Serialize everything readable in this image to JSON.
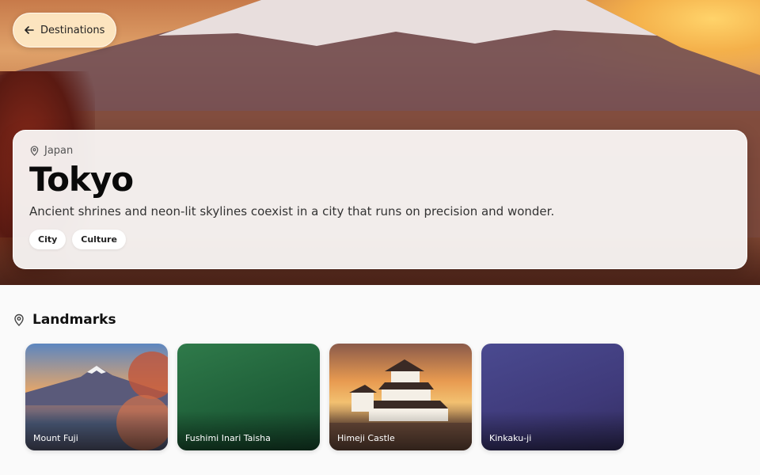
{
  "nav": {
    "back_label": "Destinations"
  },
  "hero": {
    "country": "Japan",
    "city": "Tokyo",
    "description": "Ancient shrines and neon-lit skylines coexist in a city that runs on precision and wonder.",
    "tags": [
      "City",
      "Culture"
    ]
  },
  "landmarks": {
    "title": "Landmarks",
    "items": [
      {
        "name": "Mount Fuji"
      },
      {
        "name": "Fushimi Inari Taisha"
      },
      {
        "name": "Himeji Castle"
      },
      {
        "name": "Kinkaku-ji"
      }
    ]
  },
  "icons": {
    "back": "arrow-left-icon",
    "location": "map-pin-icon"
  }
}
